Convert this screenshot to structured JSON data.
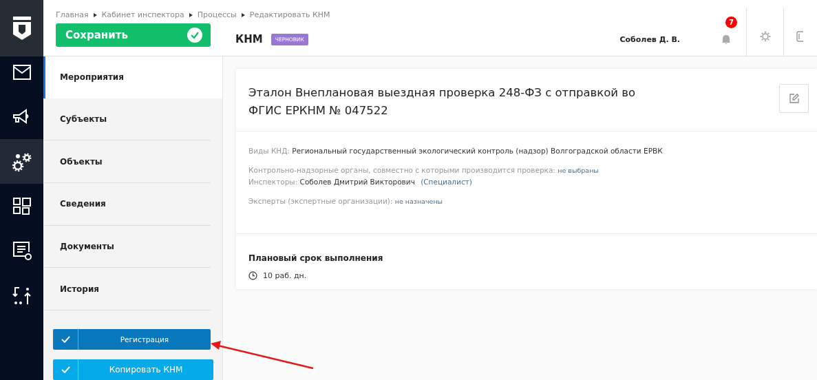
{
  "breadcrumbs": [
    "Главная",
    "Кабинет инспектора",
    "Процессы",
    "Редактировать КНМ"
  ],
  "save_button": {
    "label": "Сохранить"
  },
  "header": {
    "title": "КНМ",
    "status": "ЧЕРНОВИК",
    "user": "Соболев Д. В.",
    "notifications": "7"
  },
  "rail": [
    {
      "kind": "mail",
      "selected": false
    },
    {
      "kind": "megaphone",
      "selected": false
    },
    {
      "kind": "gears",
      "selected": true
    },
    {
      "kind": "grid",
      "selected": false
    },
    {
      "kind": "list",
      "selected": false
    },
    {
      "kind": "arrows",
      "selected": false
    }
  ],
  "menu": [
    {
      "label": "Мероприятия",
      "selected": true
    },
    {
      "label": "Субъекты",
      "selected": false
    },
    {
      "label": "Объекты",
      "selected": false
    },
    {
      "label": "Сведения",
      "selected": false
    },
    {
      "label": "Документы",
      "selected": false
    },
    {
      "label": "История",
      "selected": false
    }
  ],
  "actions": [
    {
      "label": "Регистрация",
      "kind": "primary"
    },
    {
      "label": "Копировать КНМ",
      "kind": "light"
    }
  ],
  "card": {
    "title": "Эталон Внеплановая выездная проверка 248-ФЗ с отправкой во ФГИС ЕРКНМ № 047522",
    "field_groups": [
      [
        {
          "label": "Виды КНД:",
          "parts": [
            {
              "text": "Региональный государственный экологический контроль (надзор) Волгоградской области ЕРВК",
              "kind": "text"
            }
          ]
        }
      ],
      [
        {
          "label": "Контрольно-надзорные органы, совместно с которыми производится проверка:",
          "parts": [
            {
              "text": "не выбраны",
              "kind": "link"
            }
          ]
        },
        {
          "label": "Инспекторы:",
          "parts": [
            {
              "text": "Соболев Дмитрий Викторович",
              "kind": "text"
            },
            {
              "text": "(Специалист)",
              "kind": "role"
            }
          ]
        }
      ],
      [
        {
          "label": "Эксперты (экспертные организации):",
          "parts": [
            {
              "text": "не назначены",
              "kind": "link"
            }
          ]
        }
      ]
    ],
    "deadline": {
      "heading": "Плановый срок выполнения",
      "value": "10 раб. дн."
    }
  }
}
